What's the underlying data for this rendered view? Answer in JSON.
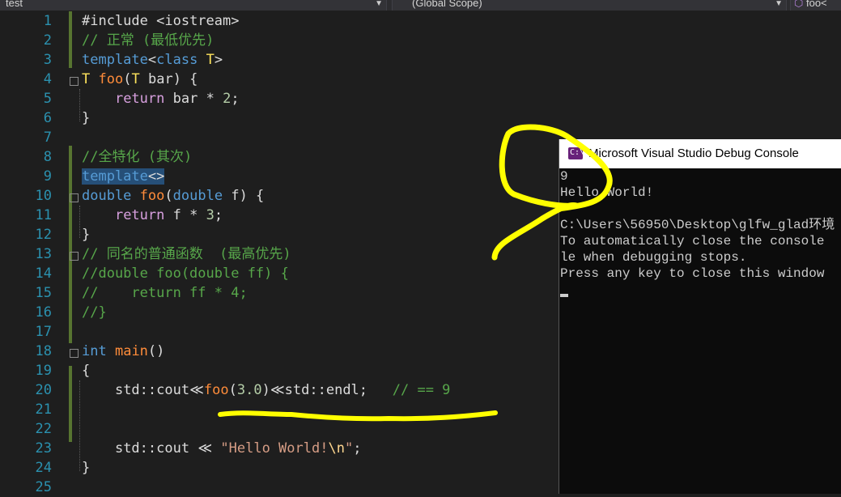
{
  "nav": {
    "project": "test",
    "scope": "(Global Scope)",
    "function": "foo<"
  },
  "editor": {
    "lines": [
      {
        "n": "1",
        "t": [
          [
            "pp",
            "#include "
          ],
          [
            "inc",
            "<iostream>"
          ]
        ]
      },
      {
        "n": "2",
        "t": [
          [
            "cm",
            "// 正常 (最低优先)"
          ]
        ]
      },
      {
        "n": "3",
        "t": [
          [
            "kw",
            "template"
          ],
          [
            "p",
            "<"
          ],
          [
            "kw",
            "class"
          ],
          [
            "p",
            " "
          ],
          [
            "tpl",
            "T"
          ],
          [
            "p",
            ">"
          ]
        ]
      },
      {
        "n": "4",
        "t": [
          [
            "tpl",
            "T"
          ],
          [
            "p",
            " "
          ],
          [
            "fn",
            "foo"
          ],
          [
            "p",
            "("
          ],
          [
            "tpl",
            "T"
          ],
          [
            "p",
            " "
          ],
          [
            "par",
            "bar"
          ],
          [
            "p",
            ") {"
          ]
        ]
      },
      {
        "n": "5",
        "t": [
          [
            "p",
            "    "
          ],
          [
            "kw2",
            "return"
          ],
          [
            "p",
            " "
          ],
          [
            "par",
            "bar"
          ],
          [
            "p",
            " * "
          ],
          [
            "num",
            "2"
          ],
          [
            "p",
            ";"
          ]
        ]
      },
      {
        "n": "6",
        "t": [
          [
            "p",
            "}"
          ]
        ]
      },
      {
        "n": "7",
        "t": []
      },
      {
        "n": "8",
        "t": [
          [
            "cm",
            "//全特化 (其次)"
          ],
          [
            "p",
            " "
          ]
        ]
      },
      {
        "n": "9",
        "t": [
          [
            "kwhl",
            "template"
          ],
          [
            "phl",
            "<>"
          ]
        ]
      },
      {
        "n": "10",
        "t": [
          [
            "kw",
            "double"
          ],
          [
            "p",
            " "
          ],
          [
            "fn",
            "foo"
          ],
          [
            "p",
            "("
          ],
          [
            "kw",
            "double"
          ],
          [
            "p",
            " "
          ],
          [
            "par",
            "f"
          ],
          [
            "p",
            ") {"
          ]
        ]
      },
      {
        "n": "11",
        "t": [
          [
            "p",
            "    "
          ],
          [
            "kw2",
            "return"
          ],
          [
            "p",
            " "
          ],
          [
            "par",
            "f"
          ],
          [
            "p",
            " * "
          ],
          [
            "num",
            "3"
          ],
          [
            "p",
            ";"
          ]
        ]
      },
      {
        "n": "12",
        "t": [
          [
            "p",
            "}"
          ]
        ]
      },
      {
        "n": "13",
        "t": [
          [
            "cm",
            "// 同名的普通函数  (最高优先)"
          ]
        ]
      },
      {
        "n": "14",
        "t": [
          [
            "cm",
            "//double foo(double ff) {"
          ]
        ]
      },
      {
        "n": "15",
        "t": [
          [
            "cm",
            "//    return ff * 4;"
          ]
        ]
      },
      {
        "n": "16",
        "t": [
          [
            "cm",
            "//}"
          ]
        ]
      },
      {
        "n": "17",
        "t": []
      },
      {
        "n": "18",
        "t": [
          [
            "kw",
            "int"
          ],
          [
            "p",
            " "
          ],
          [
            "fn",
            "main"
          ],
          [
            "p",
            "()"
          ]
        ]
      },
      {
        "n": "19",
        "t": [
          [
            "p",
            "{"
          ]
        ]
      },
      {
        "n": "20",
        "t": [
          [
            "p",
            "    "
          ],
          [
            "ty",
            "std"
          ],
          [
            "p",
            "::"
          ],
          [
            "ty",
            "cout"
          ],
          [
            "p",
            "≪"
          ],
          [
            "fn",
            "foo"
          ],
          [
            "p",
            "("
          ],
          [
            "num",
            "3.0"
          ],
          [
            "p",
            ")≪"
          ],
          [
            "ty",
            "std"
          ],
          [
            "p",
            "::"
          ],
          [
            "ty",
            "endl"
          ],
          [
            "p",
            ";   "
          ],
          [
            "cm",
            "// == 9"
          ]
        ]
      },
      {
        "n": "21",
        "t": []
      },
      {
        "n": "22",
        "t": []
      },
      {
        "n": "23",
        "t": [
          [
            "p",
            "    "
          ],
          [
            "ty",
            "std"
          ],
          [
            "p",
            "::"
          ],
          [
            "ty",
            "cout"
          ],
          [
            "p",
            " ≪ "
          ],
          [
            "str",
            "\"Hello World!"
          ],
          [
            "esc",
            "\\n"
          ],
          [
            "str",
            "\""
          ],
          [
            "p",
            ";"
          ]
        ]
      },
      {
        "n": "24",
        "t": [
          [
            "p",
            "}"
          ]
        ]
      },
      {
        "n": "25",
        "t": []
      }
    ]
  },
  "console": {
    "title": "Microsoft Visual Studio Debug Console",
    "lines": [
      "9",
      "Hello World!",
      "",
      "C:\\Users\\56950\\Desktop\\glfw_glad环境",
      "To automatically close the console",
      "le when debugging stops.",
      "Press any key to close this window"
    ]
  },
  "colors": {
    "editor_bg": "#1e1e1e",
    "keyword": "#569cd6",
    "control_keyword": "#d8a0df",
    "function": "#ff8c3a",
    "template_param": "#ffe45c",
    "comment": "#57a64a",
    "line_number": "#2b91af",
    "annotation": "#ffff00",
    "console_bg": "#0c0c0c"
  }
}
